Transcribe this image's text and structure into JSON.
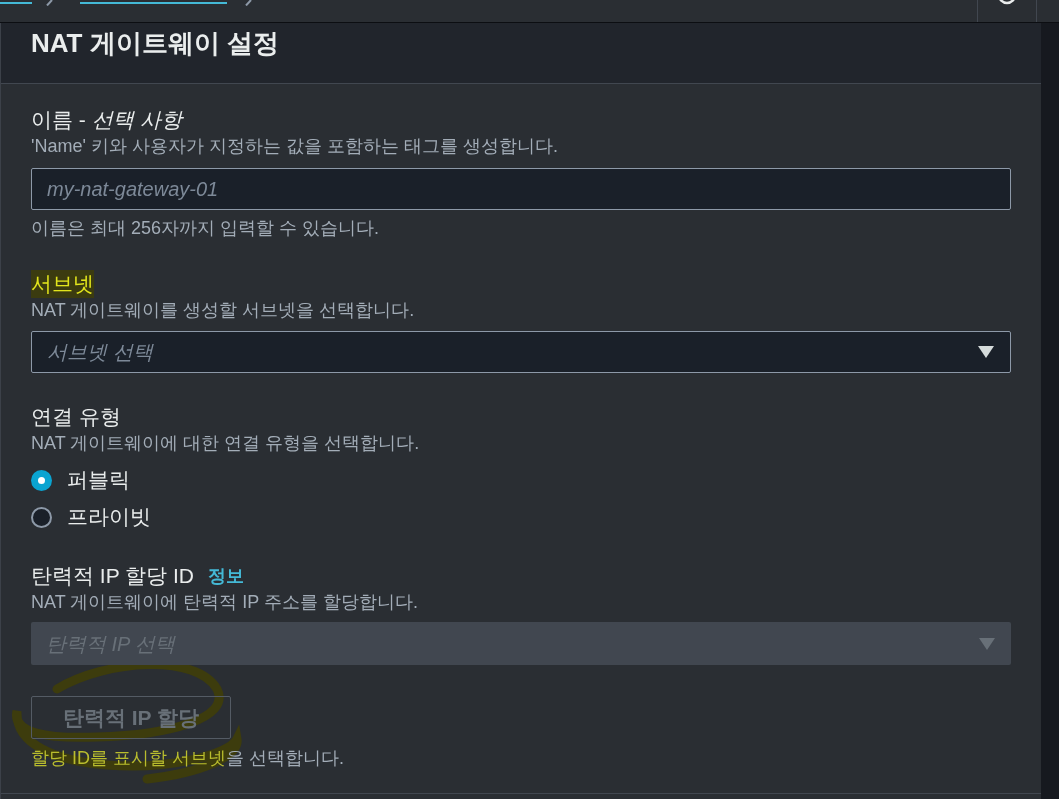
{
  "panel": {
    "title": "NAT 게이트웨이 설정"
  },
  "fields": [
    {
      "kind": "text_input",
      "label": "이름 - *선택 사항*",
      "label_highlighted": false,
      "description": "'Name' 키와 사용자가 지정하는 값을 포함하는 태그를 생성합니다.",
      "placeholder": "my-nat-gateway-01",
      "hint": "이름은 최대 256자까지 입력할 수 있습니다."
    },
    {
      "kind": "select",
      "label": "서브넷",
      "label_highlighted": true,
      "description": "NAT 게이트웨이를 생성할 서브넷을 선택합니다.",
      "placeholder": "서브넷 선택",
      "disabled": false
    },
    {
      "kind": "radio_group",
      "label": "연결 유형",
      "label_highlighted": false,
      "description": "NAT 게이트웨이에 대한 연결 유형을 선택합니다.",
      "options": [
        {
          "label": "퍼블릭",
          "selected": true
        },
        {
          "label": "프라이빗",
          "selected": false
        }
      ]
    },
    {
      "kind": "select",
      "label": "탄력적 IP 할당 ID",
      "label_highlighted": false,
      "info_link": "정보",
      "description": "NAT 게이트웨이에 탄력적 IP 주소를 할당합니다.",
      "placeholder": "탄력적 IP 선택",
      "disabled": true,
      "button": {
        "label": "탄력적 IP 할당",
        "disabled": true
      },
      "hint_parts": [
        {
          "text": "할당 ID를 표시할 서브넷",
          "highlighted": true
        },
        {
          "text": "을 선택합니다.",
          "highlighted": false
        }
      ]
    }
  ]
}
